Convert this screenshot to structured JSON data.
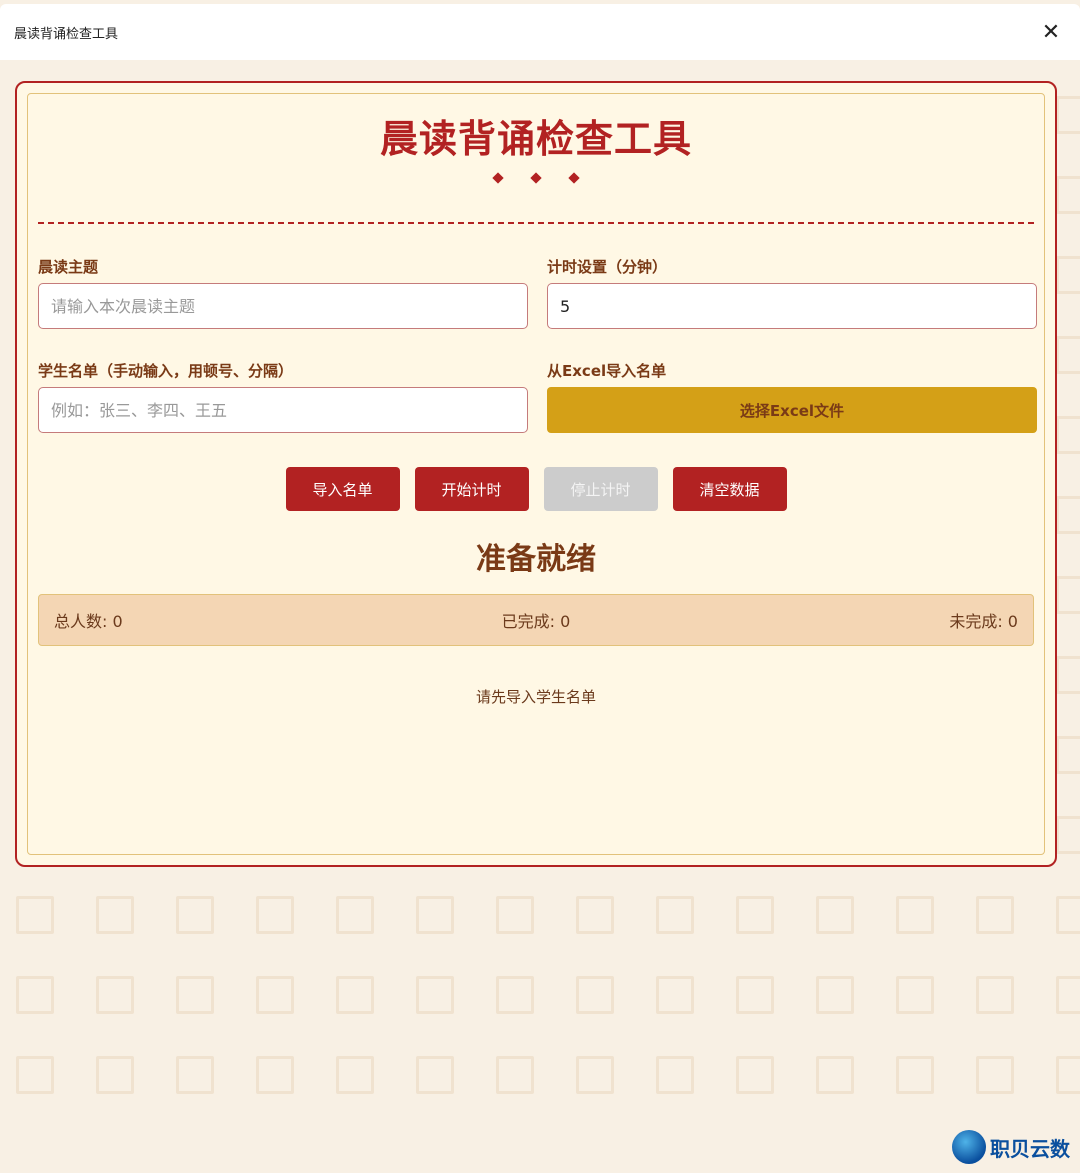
{
  "window": {
    "title": "晨读背诵检查工具",
    "close_glyph": "✕"
  },
  "app": {
    "title": "晨读背诵检查工具"
  },
  "form": {
    "topic_label": "晨读主题",
    "topic_placeholder": "请输入本次晨读主题",
    "topic_value": "",
    "timer_label": "计时设置（分钟）",
    "timer_value": "5",
    "students_label": "学生名单（手动输入，用顿号、分隔）",
    "students_placeholder": "例如：张三、李四、王五",
    "students_value": "",
    "excel_label": "从Excel导入名单",
    "excel_button": "选择Excel文件"
  },
  "actions": {
    "import_label": "导入名单",
    "start_label": "开始计时",
    "stop_label": "停止计时",
    "clear_label": "清空数据"
  },
  "status": {
    "text": "准备就绪"
  },
  "stats": {
    "total": "总人数: 0",
    "done": "已完成: 0",
    "undone": "未完成: 0"
  },
  "hint": "请先导入学生名单",
  "watermark": {
    "text": "职贝云数"
  },
  "colors": {
    "primary_red": "#b22222",
    "excel_gold": "#d4a017",
    "text_brown": "#7a3a16",
    "card_bg": "#fff8e5",
    "stats_bg": "#f4d6b4",
    "disabled_gray": "#cccccc"
  }
}
